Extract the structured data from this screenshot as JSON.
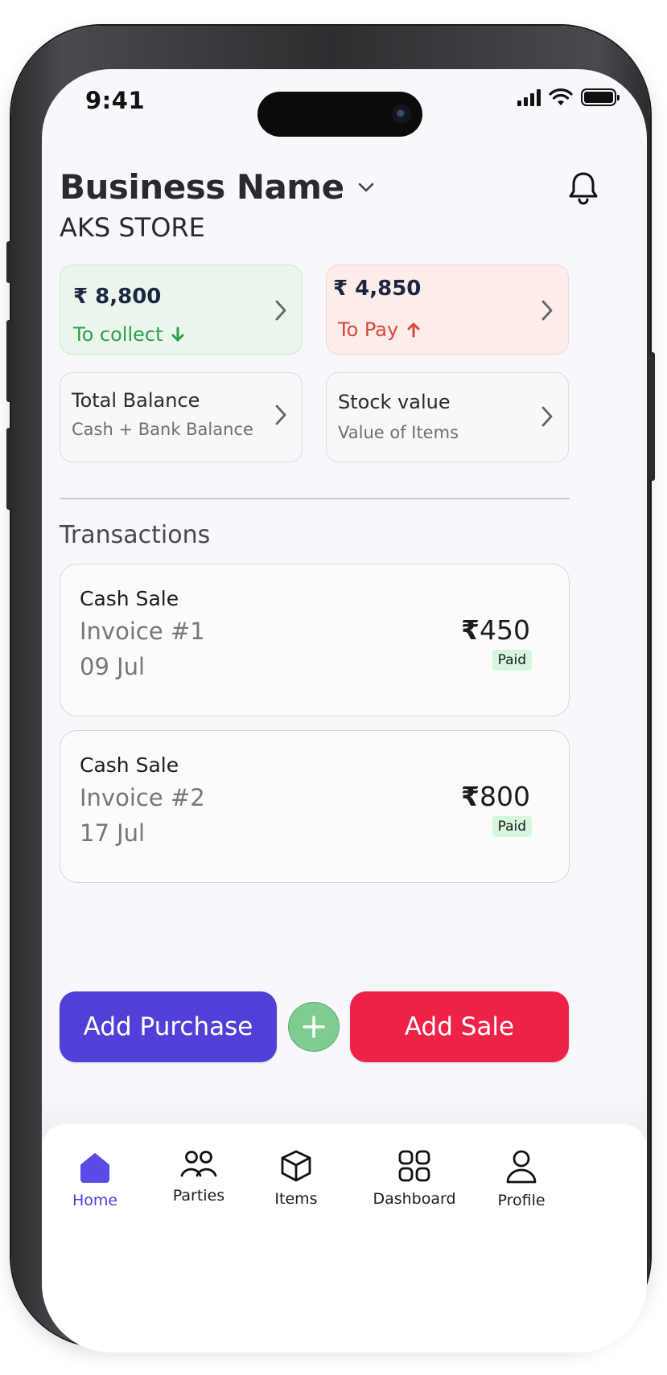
{
  "status_bar": {
    "time": "9:41"
  },
  "header": {
    "business_label": "Business Name",
    "store_name": "AKS STORE"
  },
  "summary": {
    "collect": {
      "amount": "₹ 8,800",
      "label": "To collect"
    },
    "pay": {
      "amount": "₹ 4,850",
      "label": "To Pay"
    },
    "total_balance": {
      "title": "Total Balance",
      "desc": "Cash + Bank Balance"
    },
    "stock_value": {
      "title": "Stock value",
      "desc": "Value of Items"
    }
  },
  "transactions": {
    "title": "Transactions",
    "items": [
      {
        "kind": "Cash Sale",
        "invoice": "Invoice #1",
        "date": "09 Jul",
        "rupee": "₹",
        "amount": "450",
        "status": "Paid"
      },
      {
        "kind": "Cash Sale",
        "invoice": "Invoice #2",
        "date": "17 Jul",
        "rupee": "₹",
        "amount": "800",
        "status": "Paid"
      }
    ]
  },
  "actions": {
    "add_purchase": "Add Purchase",
    "add_sale": "Add Sale"
  },
  "nav": {
    "items": [
      {
        "label": "Home",
        "icon": "home-icon"
      },
      {
        "label": "Parties",
        "icon": "parties-icon"
      },
      {
        "label": "Items",
        "icon": "box-icon"
      },
      {
        "label": "Dashboard",
        "icon": "dashboard-icon"
      },
      {
        "label": "Profile",
        "icon": "profile-icon"
      }
    ],
    "active": "Home"
  },
  "colors": {
    "collect_green": "#2e9e4a",
    "pay_red": "#d9483b",
    "purchase_button": "#5040d8",
    "sale_button": "#ee2246",
    "fab_green": "#7fcc93",
    "active_nav": "#4a3ee0",
    "collect_card_bg": "#eaf6ec",
    "pay_card_bg": "#fcecea"
  }
}
